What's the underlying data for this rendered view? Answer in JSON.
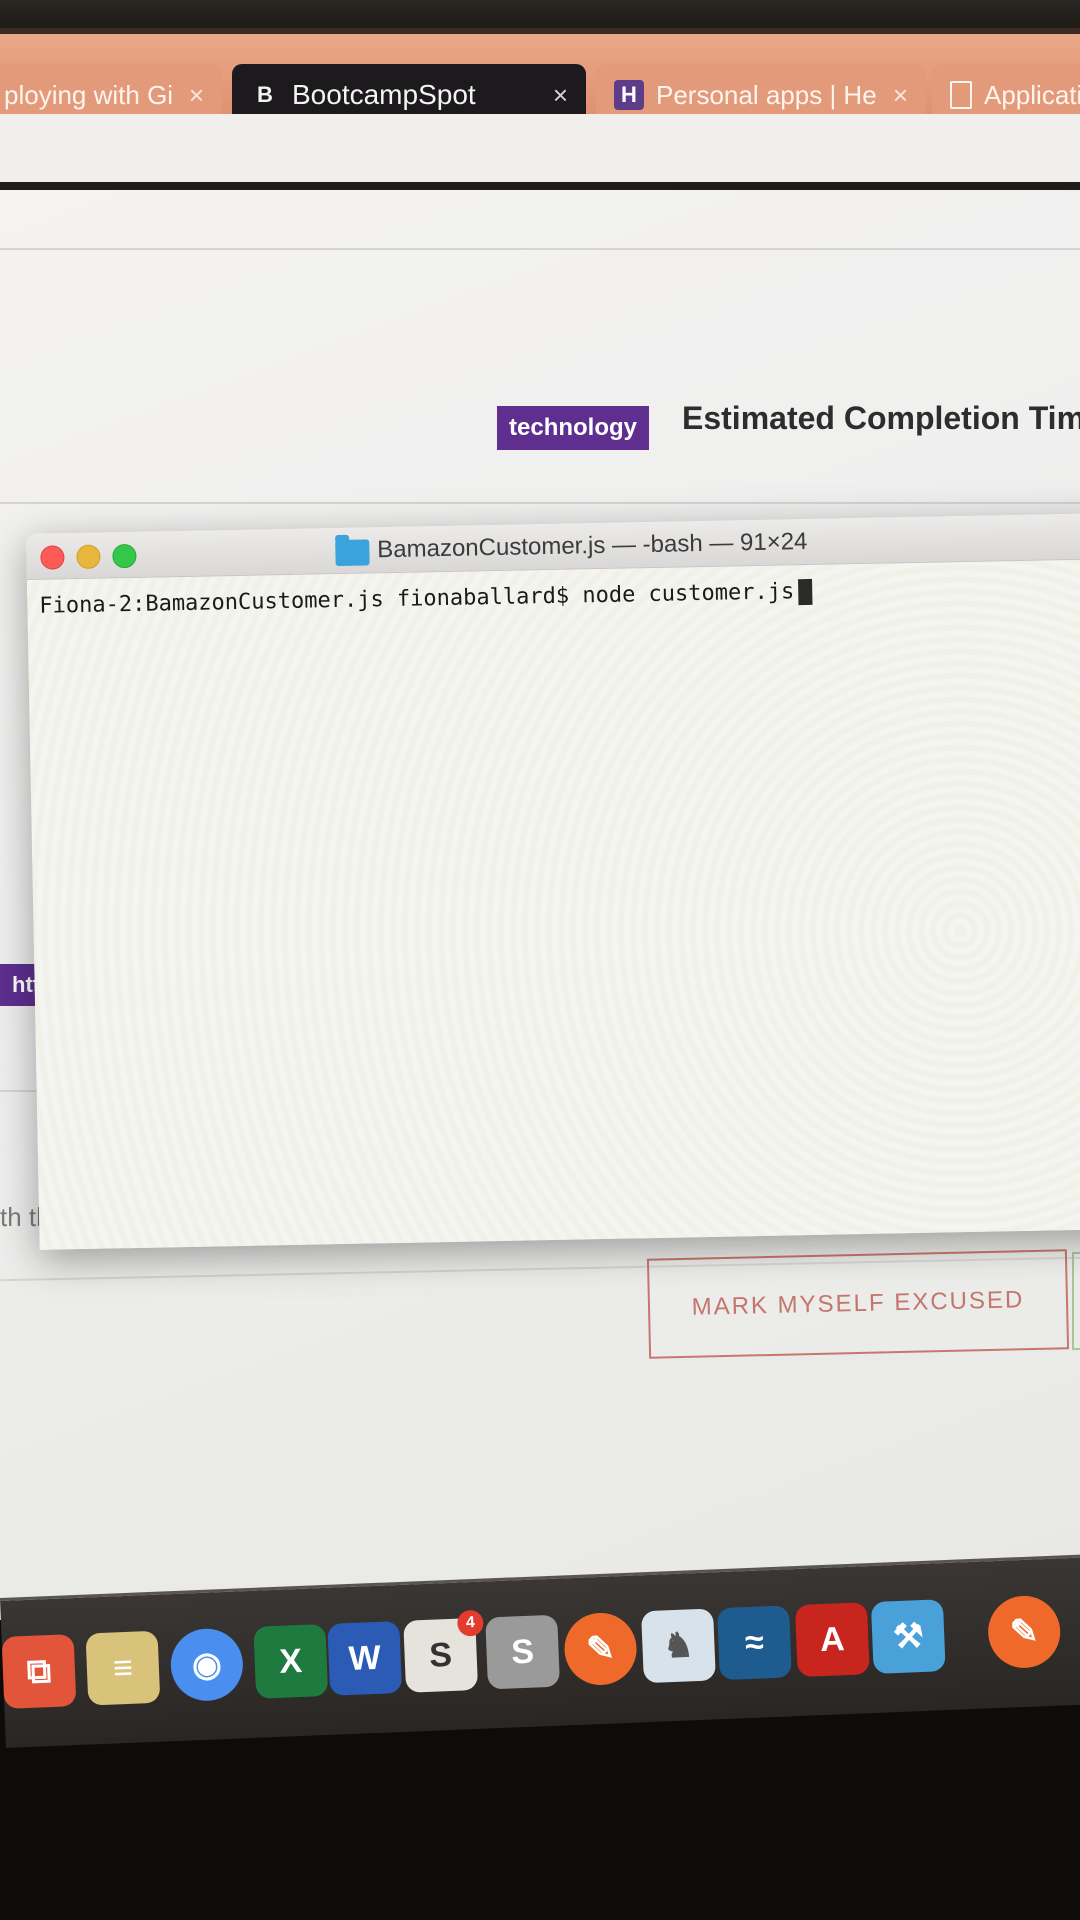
{
  "browser": {
    "tabs": [
      {
        "label": "ploying with Gi",
        "favicon": "none",
        "active": false
      },
      {
        "label": "BootcampSpot",
        "favicon": "B",
        "active": true
      },
      {
        "label": "Personal apps | He",
        "favicon": "H",
        "active": false
      },
      {
        "label": "Applicati",
        "favicon": "doc-icon",
        "active": false
      }
    ],
    "close_glyph": "×"
  },
  "page": {
    "tag": "technology",
    "heading": "Estimated Completion Time",
    "url_fragment": "https",
    "text_fragment": "th the",
    "excuse_button": "MARK MYSELF EXCUSED"
  },
  "terminal": {
    "title": "BamazonCustomer.js — -bash — 91×24",
    "prompt": "Fiona-2:BamazonCustomer.js fionaballard$ node customer.js"
  },
  "dock": {
    "items": [
      {
        "name": "screen-sharing",
        "color": "#e2553a"
      },
      {
        "name": "notes",
        "color": "#d9c27a"
      },
      {
        "name": "chrome",
        "color": "#4a8ef0"
      },
      {
        "name": "excel",
        "color": "#1f7a40"
      },
      {
        "name": "word",
        "color": "#2b5bb5"
      },
      {
        "name": "slack",
        "color": "#e6e2dc",
        "badge": "4"
      },
      {
        "name": "sublime",
        "color": "#9a9a9a"
      },
      {
        "name": "postman",
        "color": "#ef6a2a"
      },
      {
        "name": "postgres",
        "color": "#d7e2ea"
      },
      {
        "name": "mysql-workbench",
        "color": "#1e5b8f"
      },
      {
        "name": "acrobat",
        "color": "#c8251f"
      },
      {
        "name": "xcode",
        "color": "#4aa0d8"
      },
      {
        "name": "postman-2",
        "color": "#ef6a2a"
      }
    ]
  }
}
